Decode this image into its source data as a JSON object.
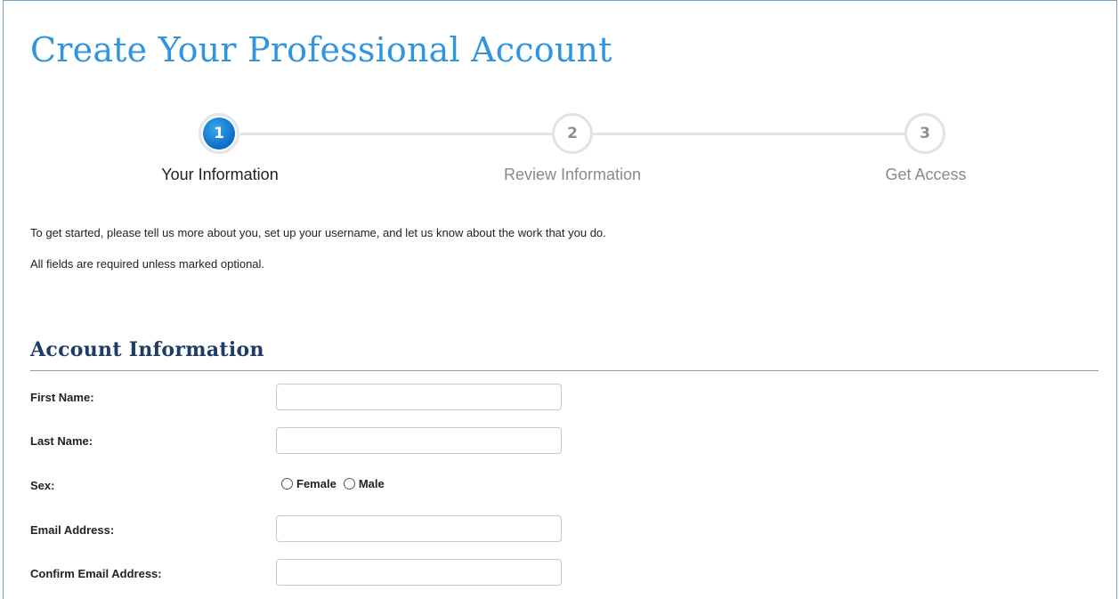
{
  "page": {
    "title": "Create Your Professional Account"
  },
  "steps": [
    {
      "number": "1",
      "label": "Your Information",
      "state": "active"
    },
    {
      "number": "2",
      "label": "Review Information",
      "state": "inactive"
    },
    {
      "number": "3",
      "label": "Get Access",
      "state": "inactive"
    }
  ],
  "intro": {
    "line1": "To get started, please tell us more about you, set up your username, and let us know about the work that you do.",
    "line2": "All fields are required unless marked optional."
  },
  "section": {
    "title": "Account Information"
  },
  "fields": {
    "first_name": {
      "label": "First Name:",
      "value": ""
    },
    "last_name": {
      "label": "Last Name:",
      "value": ""
    },
    "sex": {
      "label": "Sex:",
      "options": [
        "Female",
        "Male"
      ],
      "selected": null
    },
    "email": {
      "label": "Email Address:",
      "value": ""
    },
    "confirm_email": {
      "label": "Confirm Email Address:",
      "value": ""
    }
  },
  "colors": {
    "title_blue": "#2f95e0",
    "section_navy": "#1d3c66",
    "active_step": "#1478d0"
  }
}
